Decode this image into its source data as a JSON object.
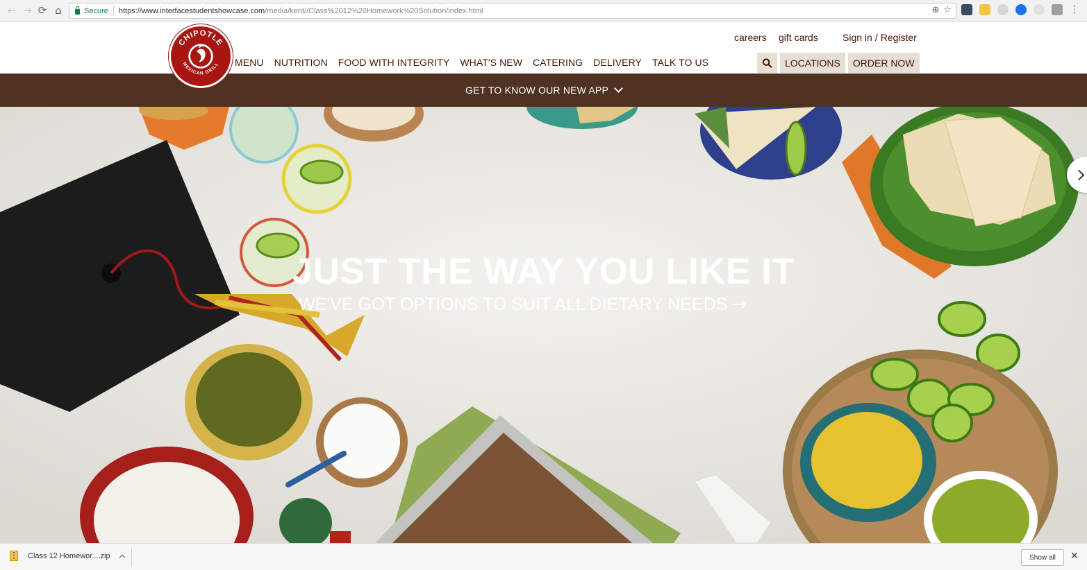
{
  "browser": {
    "secure_label": "Secure",
    "url_host": "https://www.interfacestudentshowcase.com",
    "url_path": "/media/kent//Class%2012%20Homework%20Solution/index.html"
  },
  "header": {
    "logo_text_top": "CHIPOTLE",
    "logo_text_bottom": "MEXICAN GRILL",
    "utility": {
      "careers": "careers",
      "gift_cards": "gift cards",
      "sign_in": "Sign in",
      "separator": "/",
      "register": "Register"
    },
    "nav": [
      "MENU",
      "NUTRITION",
      "FOOD WITH INTEGRITY",
      "WHAT'S NEW",
      "CATERING",
      "DELIVERY",
      "TALK TO US"
    ],
    "locations": "LOCATIONS",
    "order_now": "ORDER NOW"
  },
  "app_banner": {
    "label": "GET TO KNOW OUR NEW APP"
  },
  "hero": {
    "title": "JUST THE WAY YOU LIKE IT",
    "subtitle": "WE'VE GOT OPTIONS TO SUIT ALL DIETARY NEEDS",
    "arrow": "→"
  },
  "download_bar": {
    "file_name": "Class 12 Homewor....zip",
    "show_all": "Show all",
    "close": "✕"
  },
  "colors": {
    "brand_red": "#a81612",
    "brand_brown": "#451400",
    "banner_brown": "#4f3221",
    "button_bg": "#e5dfd6"
  }
}
